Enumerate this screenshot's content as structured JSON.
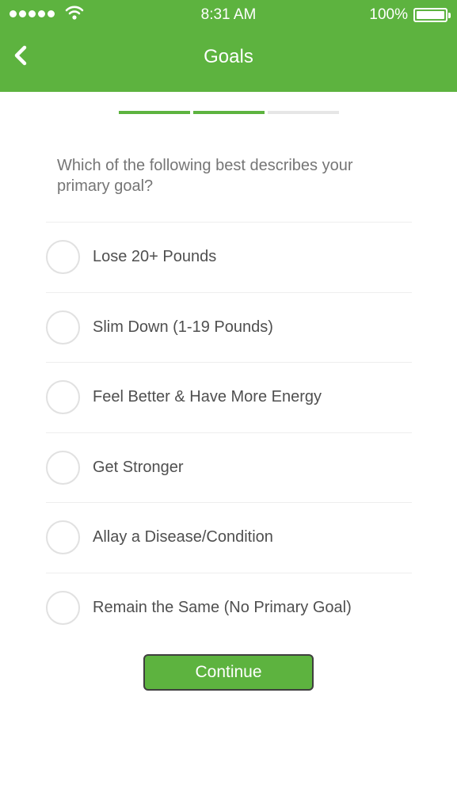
{
  "status_bar": {
    "time": "8:31 AM",
    "battery": "100%",
    "signal_icon": "signal-dots-icon",
    "wifi_icon": "wifi-icon",
    "battery_icon": "battery-icon"
  },
  "header": {
    "title": "Goals",
    "back_icon": "chevron-left-icon",
    "color": "#5db33f"
  },
  "progress": {
    "steps_total": 3,
    "steps_completed": 2
  },
  "question": "Which of the following best describes your primary goal?",
  "options": [
    {
      "label": "Lose 20+ Pounds",
      "selected": false
    },
    {
      "label": "Slim Down (1-19 Pounds)",
      "selected": false
    },
    {
      "label": "Feel Better & Have More Energy",
      "selected": false
    },
    {
      "label": "Get Stronger",
      "selected": false
    },
    {
      "label": "Allay a Disease/Condition",
      "selected": false
    },
    {
      "label": "Remain the Same (No Primary Goal)",
      "selected": false
    }
  ],
  "continue_label": "Continue"
}
